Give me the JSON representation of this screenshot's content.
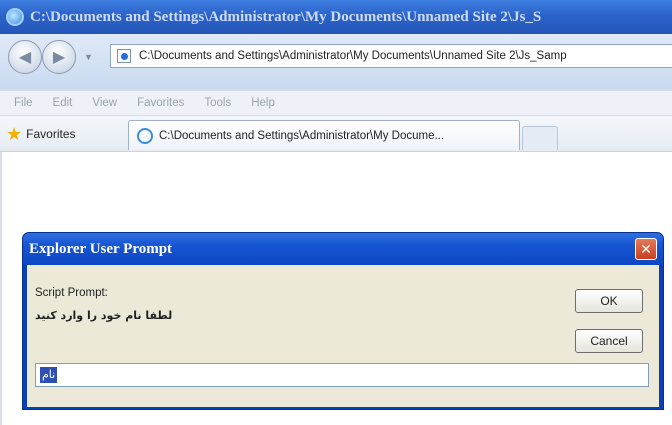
{
  "window": {
    "title": "C:\\Documents and Settings\\Administrator\\My Documents\\Unnamed Site 2\\Js_S"
  },
  "address": {
    "url": "C:\\Documents and Settings\\Administrator\\My Documents\\Unnamed Site 2\\Js_Samp"
  },
  "menu": {
    "items": [
      "File",
      "Edit",
      "View",
      "Favorites",
      "Tools",
      "Help"
    ]
  },
  "favorites": {
    "label": "Favorites"
  },
  "tab": {
    "label": "C:\\Documents and Settings\\Administrator\\My Docume..."
  },
  "dialog": {
    "title": "Explorer User Prompt",
    "prompt_label": "Script Prompt:",
    "message": "لطفا نام خود را وارد کنید",
    "ok_label": "OK",
    "cancel_label": "Cancel",
    "input_value": "نام"
  }
}
